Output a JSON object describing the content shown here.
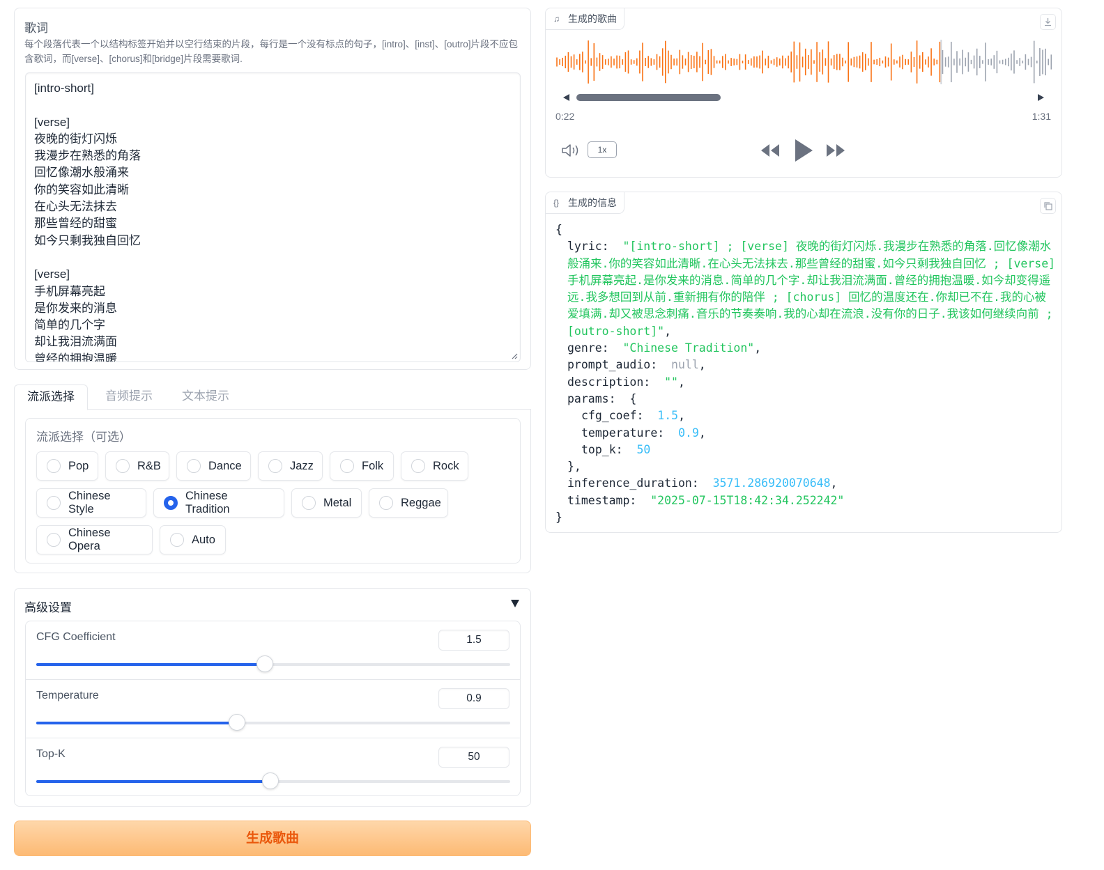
{
  "lyrics": {
    "title": "歌词",
    "info": "每个段落代表一个以结构标签开始并以空行结束的片段，每行是一个没有标点的句子，[intro]、[inst]、[outro]片段不应包含歌词，而[verse]、[chorus]和[bridge]片段需要歌词.",
    "text": "[intro-short]\n\n[verse]\n夜晚的街灯闪烁\n我漫步在熟悉的角落\n回忆像潮水般涌来\n你的笑容如此清晰\n在心头无法抹去\n那些曾经的甜蜜\n如今只剩我独自回忆\n\n[verse]\n手机屏幕亮起\n是你发来的消息\n简单的几个字\n却让我泪流满面\n曾经的拥抱温暖"
  },
  "tabs": [
    {
      "label": "流派选择",
      "active": true
    },
    {
      "label": "音频提示",
      "active": false
    },
    {
      "label": "文本提示",
      "active": false
    }
  ],
  "genre": {
    "label": "流派选择（可选）",
    "selected": "Chinese Tradition",
    "options": [
      "Pop",
      "R&B",
      "Dance",
      "Jazz",
      "Folk",
      "Rock",
      "Chinese Style",
      "Chinese Tradition",
      "Metal",
      "Reggae",
      "Chinese Opera",
      "Auto"
    ]
  },
  "advanced": {
    "title": "高级设置",
    "sliders": [
      {
        "label": "CFG Coefficient",
        "value": "1.5",
        "fraction": 0.483
      },
      {
        "label": "Temperature",
        "value": "0.9",
        "fraction": 0.424
      },
      {
        "label": "Top-K",
        "value": "50",
        "fraction": 0.494
      }
    ]
  },
  "generate_button": "生成歌曲",
  "audio": {
    "label": "生成的歌曲",
    "current_time": "0:22",
    "duration": "1:31",
    "playback_rate": "1x",
    "progress": 0.242,
    "played_color": "#f97316",
    "unplayed_color": "#9ca3af"
  },
  "info": {
    "label": "生成的信息",
    "lyric_key": "lyric:",
    "lyric_value": "\"[intro-short] ; [verse] 夜晚的街灯闪烁.我漫步在熟悉的角落.回忆像潮水般涌来.你的笑容如此清晰.在心头无法抹去.那些曾经的甜蜜.如今只剩我独自回忆 ; [verse] 手机屏幕亮起.是你发来的消息.简单的几个字.却让我泪流满面.曾经的拥抱温暖.如今却变得遥远.我多想回到从前.重新拥有你的陪伴 ; [chorus] 回忆的温度还在.你却已不在.我的心被爱填满.却又被思念刺痛.音乐的节奏奏响.我的心却在流浪.没有你的日子.我该如何继续向前 ; [outro-short]\"",
    "genre_key": "genre:",
    "genre_value": "\"Chinese Tradition\"",
    "prompt_audio_key": "prompt_audio:",
    "prompt_audio_value": "null",
    "description_key": "description:",
    "description_value": "\"\"",
    "params_key": "params:",
    "cfg_coef_key": "cfg_coef:",
    "cfg_coef_value": "1.5",
    "temperature_key": "temperature:",
    "temperature_value": "0.9",
    "top_k_key": "top_k:",
    "top_k_value": "50",
    "inference_duration_key": "inference_duration:",
    "inference_duration_value": "3571.286920070648",
    "timestamp_key": "timestamp:",
    "timestamp_value": "\"2025-07-15T18:42:34.252242\""
  }
}
